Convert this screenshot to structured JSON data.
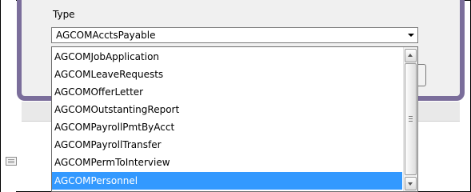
{
  "form": {
    "type_label": "Type",
    "selected_value": "AGCOMAcctsPayable"
  },
  "dropdown": {
    "items": [
      {
        "label": "AGCOMJobApplication",
        "selected": false
      },
      {
        "label": "AGCOMLeaveRequests",
        "selected": false
      },
      {
        "label": "AGCOMOfferLetter",
        "selected": false
      },
      {
        "label": "AGCOMOutstantingReport",
        "selected": false
      },
      {
        "label": "AGCOMPayrollPmtByAcct",
        "selected": false
      },
      {
        "label": "AGCOMPayrollTransfer",
        "selected": false
      },
      {
        "label": "AGCOMPermToInterview",
        "selected": false
      },
      {
        "label": "AGCOMPersonnel",
        "selected": true
      }
    ]
  },
  "colors": {
    "dialog_border": "#7b6e9b",
    "selection": "#3399ff"
  },
  "icons": {
    "combo_arrow": "chevron-down-icon",
    "scroll_up": "scroll-up-arrow-icon",
    "scroll_down": "scroll-down-arrow-icon",
    "side_document": "document-icon"
  }
}
